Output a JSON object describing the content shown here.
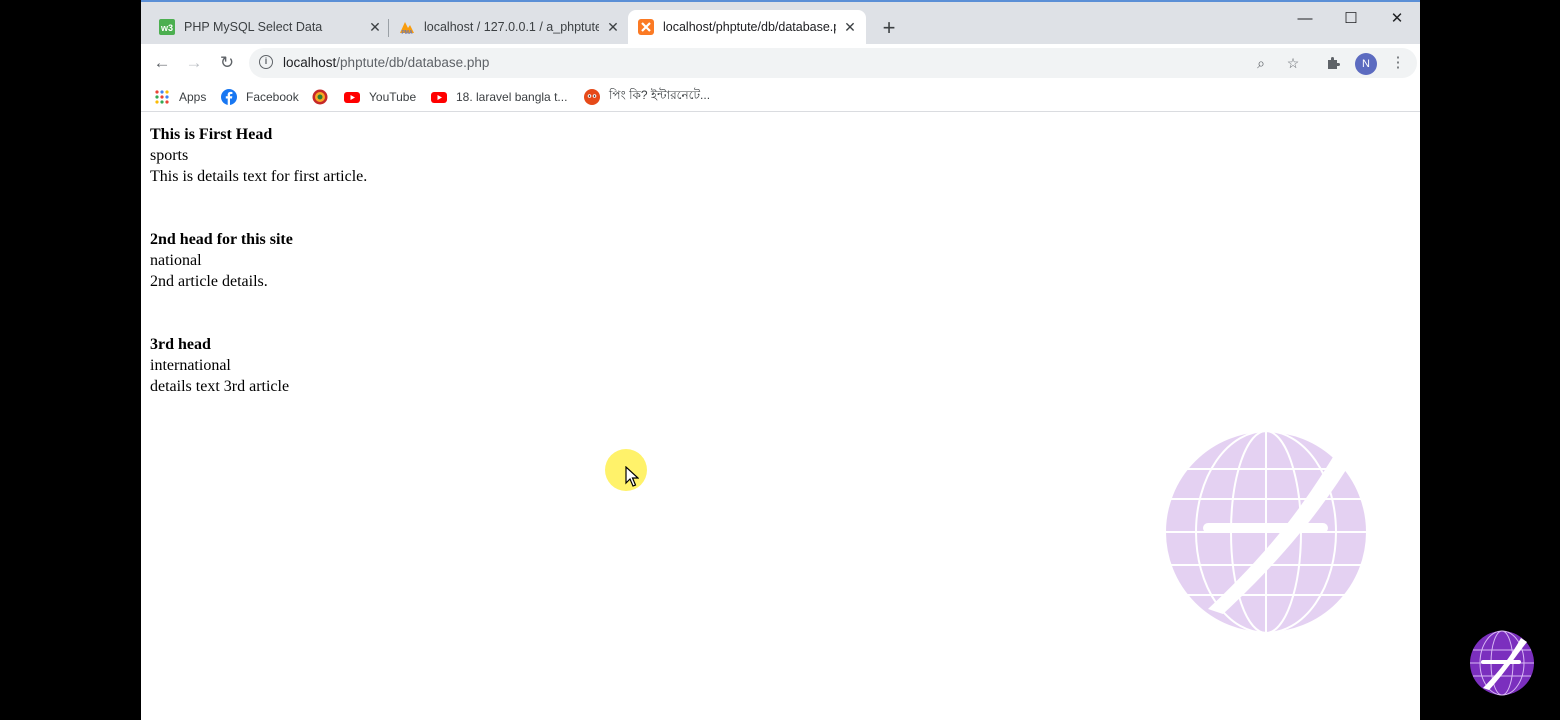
{
  "browser": {
    "tabs": [
      {
        "title": "PHP MySQL Select Data",
        "active": false
      },
      {
        "title": "localhost / 127.0.0.1 / a_phptute",
        "active": false
      },
      {
        "title": "localhost/phptute/db/database.php",
        "active": true
      }
    ],
    "window_controls": {
      "minimize": "—",
      "maximize": "☐",
      "close": "✕"
    },
    "url": {
      "host": "localhost",
      "path": "/phptute/db/database.php"
    },
    "bookmarks": [
      {
        "label": "Apps"
      },
      {
        "label": "Facebook"
      },
      {
        "label": ""
      },
      {
        "label": "YouTube"
      },
      {
        "label": "18. laravel bangla t..."
      },
      {
        "label": "পিং কি? ইন্টারনেটে..."
      }
    ],
    "profile_initial": "N"
  },
  "articles": [
    {
      "head": "This is First Head",
      "category": "sports",
      "details": "This is details text for first article."
    },
    {
      "head": "2nd head for this site",
      "category": "national",
      "details": "2nd article details."
    },
    {
      "head": "3rd head",
      "category": "international",
      "details": "details text 3rd article"
    }
  ],
  "colors": {
    "tab_strip": "#dee1e6",
    "omnibox": "#f1f3f4",
    "avatar": "#5c6bc0",
    "youtube": "#ff0000",
    "facebook": "#1877f2",
    "watermark": "#b57edc"
  }
}
